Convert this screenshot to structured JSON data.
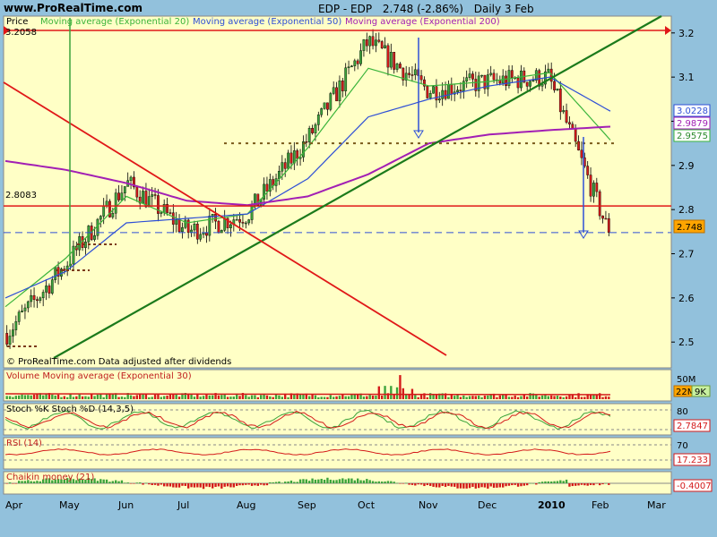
{
  "header": {
    "site": "www.ProRealTime.com",
    "symbol": "EDP - EDP",
    "quote": "2.748 (-2.86%)",
    "period": "Daily 3 Feb"
  },
  "main_panel": {
    "price_label": "Price",
    "ema20_label": "Moving average (Exponential 20)",
    "ema50_label": "Moving average (Exponential 50)",
    "ema200_label": "Moving average (Exponential 200)",
    "corner_value": "3.2058",
    "support_value": "2.8083",
    "footer_note": "© ProRealTime.com  Data adjusted after dividends",
    "y_ticks": [
      "3.2",
      "3.1",
      "3",
      "2.9",
      "2.8",
      "2.7",
      "2.6",
      "2.5"
    ],
    "tags": {
      "ema50": "3.0228",
      "ema200": "2.9879",
      "ema20": "2.9575",
      "price": "2.748"
    }
  },
  "volume_panel": {
    "label": "Volume Moving average (Exponential 30)",
    "scale": "50M",
    "tag_volume": "22M",
    "tag_ema": "9K"
  },
  "stoch_panel": {
    "label": "Stoch %K Stoch %D (14,3,5)",
    "scale": "80",
    "tag": "2.7847"
  },
  "rsi_panel": {
    "label": "RSI (14)",
    "scale": "70",
    "tag": "17.233"
  },
  "chaikin_panel": {
    "label": "Chaikin money (21)",
    "tag": "-0.4007"
  },
  "x_labels": [
    "Apr",
    "May",
    "Jun",
    "Jul",
    "Aug",
    "Sep",
    "Oct",
    "Nov",
    "Dec",
    "2010",
    "Jan",
    "Feb",
    "Mar"
  ],
  "chart_data": [
    {
      "type": "line",
      "x_categories": [
        "Apr",
        "May",
        "Jun",
        "Jul",
        "Aug",
        "Sep",
        "Oct",
        "Nov",
        "Dec",
        "Jan",
        "Feb"
      ],
      "series": [
        {
          "name": "Price",
          "values": [
            2.52,
            2.68,
            2.86,
            2.75,
            2.79,
            2.96,
            3.18,
            3.07,
            3.09,
            3.1,
            2.748
          ]
        },
        {
          "name": "Moving average (Exponential 20)",
          "values": [
            2.58,
            2.69,
            2.83,
            2.77,
            2.79,
            2.94,
            3.12,
            3.08,
            3.09,
            3.11,
            2.9575
          ]
        },
        {
          "name": "Moving average (Exponential 50)",
          "values": [
            2.6,
            2.66,
            2.77,
            2.78,
            2.79,
            2.87,
            3.01,
            3.05,
            3.08,
            3.1,
            3.0228
          ]
        },
        {
          "name": "Moving average (Exponential 200)",
          "values": [
            2.91,
            2.89,
            2.86,
            2.82,
            2.81,
            2.83,
            2.88,
            2.95,
            2.97,
            2.98,
            2.9879
          ]
        }
      ],
      "ylim": [
        2.47,
        3.23
      ],
      "last_close": 2.748
    },
    {
      "type": "bar",
      "label": "Volume Moving average (Exponential 30)",
      "ylim": [
        0,
        50
      ]
    },
    {
      "type": "line",
      "label": "Stoch %K Stoch %D (14,3,5)",
      "ylim": [
        0,
        100
      ]
    },
    {
      "type": "line",
      "label": "RSI (14)",
      "ylim": [
        0,
        100
      ]
    },
    {
      "type": "bar",
      "label": "Chaikin money (21)"
    }
  ],
  "colors": {
    "background": "#FFFFC6",
    "frame": "#92C1DC",
    "up": "#3BA33B",
    "down": "#D41A1A",
    "ema20": "#3BB43B",
    "ema50": "#2E4FD6",
    "ema200": "#A21FB4",
    "trend_green": "#1B7A1B",
    "trend_red": "#E01818"
  }
}
